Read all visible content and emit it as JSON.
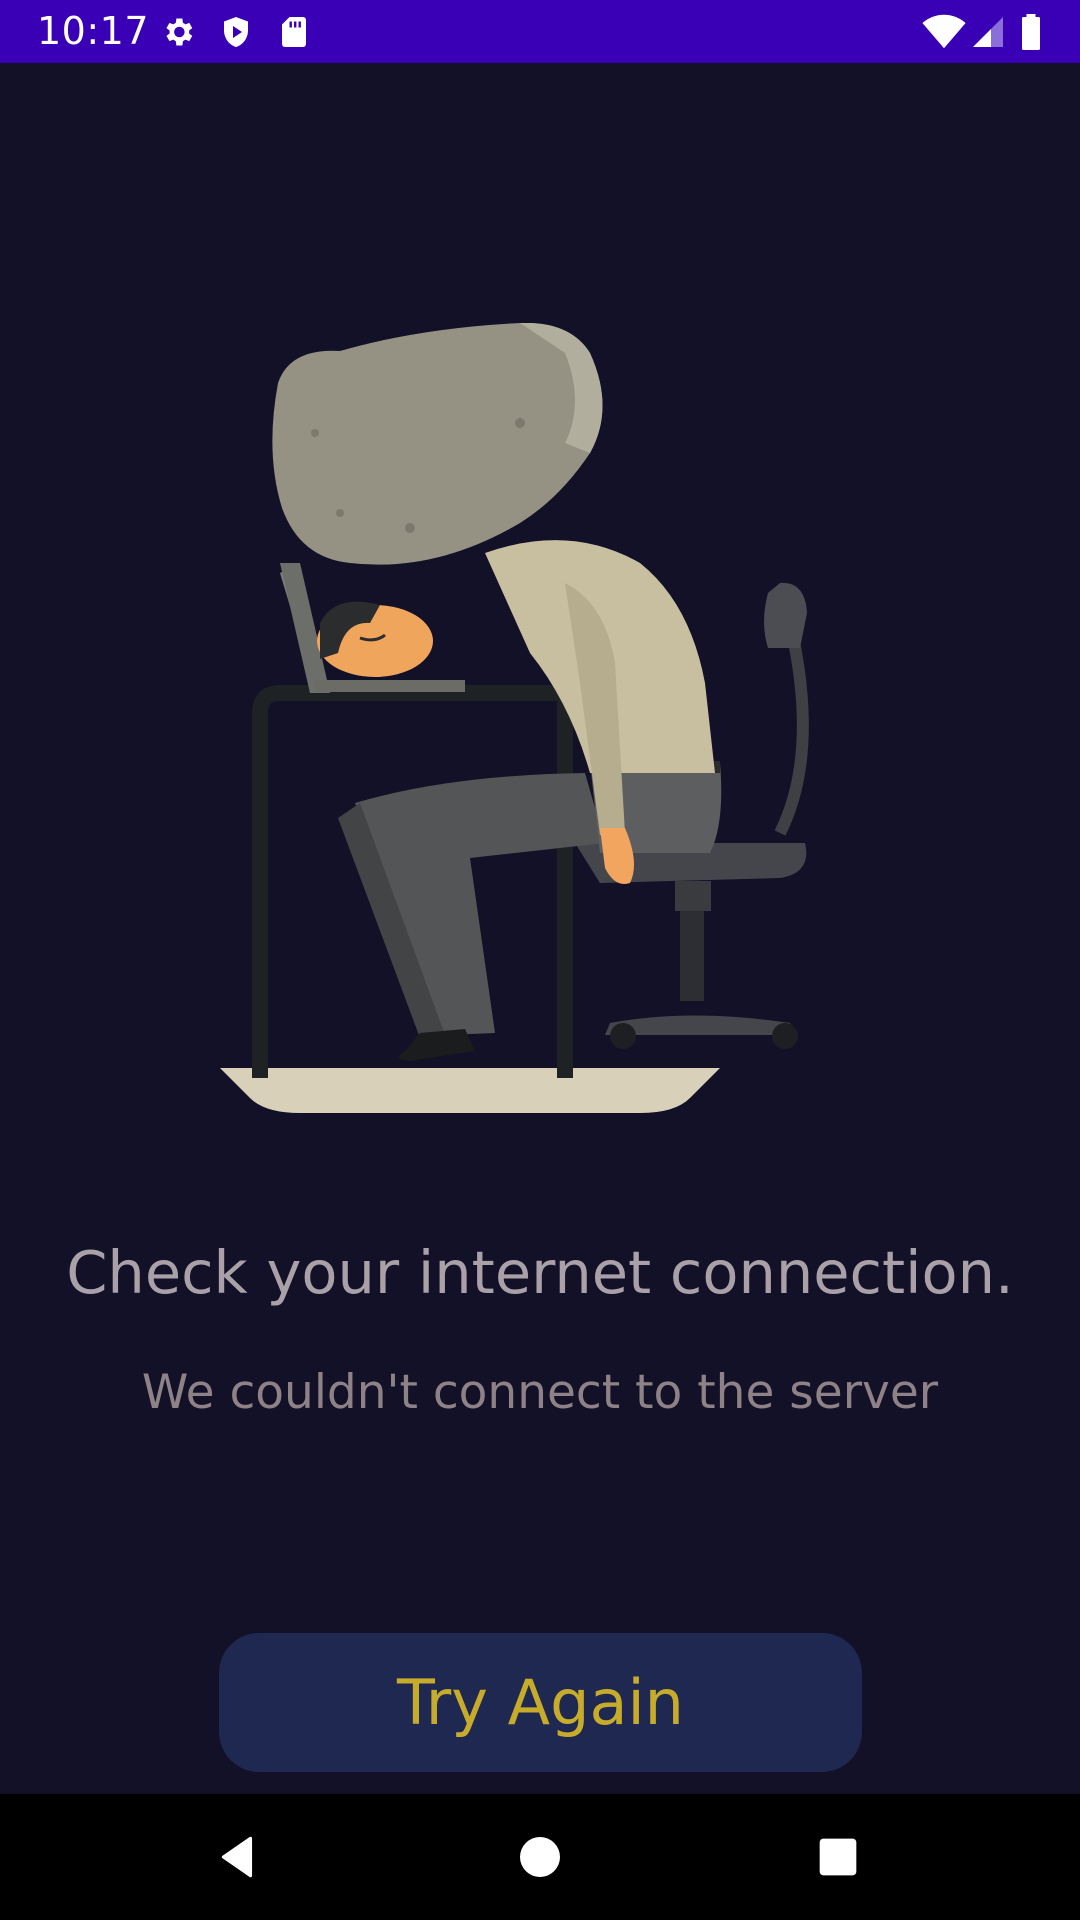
{
  "status_bar": {
    "time": "10:17",
    "left_icons": [
      "settings-icon",
      "shield-play-icon",
      "sd-card-icon"
    ],
    "right_icons": [
      "wifi-icon",
      "cell-signal-icon",
      "battery-icon"
    ],
    "background": "#3a00b5"
  },
  "error_screen": {
    "illustration": "tired-worker-under-rock-illustration",
    "title": "Check your internet connection.",
    "subtitle": "We couldn't connect to the server",
    "button_label": "Try Again"
  },
  "nav_bar": {
    "buttons": [
      "back-icon",
      "home-icon",
      "recents-icon"
    ]
  },
  "colors": {
    "background": "#121127",
    "title": "#a9a0a8",
    "subtitle": "#8e8287",
    "button_bg": "#1e2851",
    "button_text": "#c7ab2a"
  }
}
